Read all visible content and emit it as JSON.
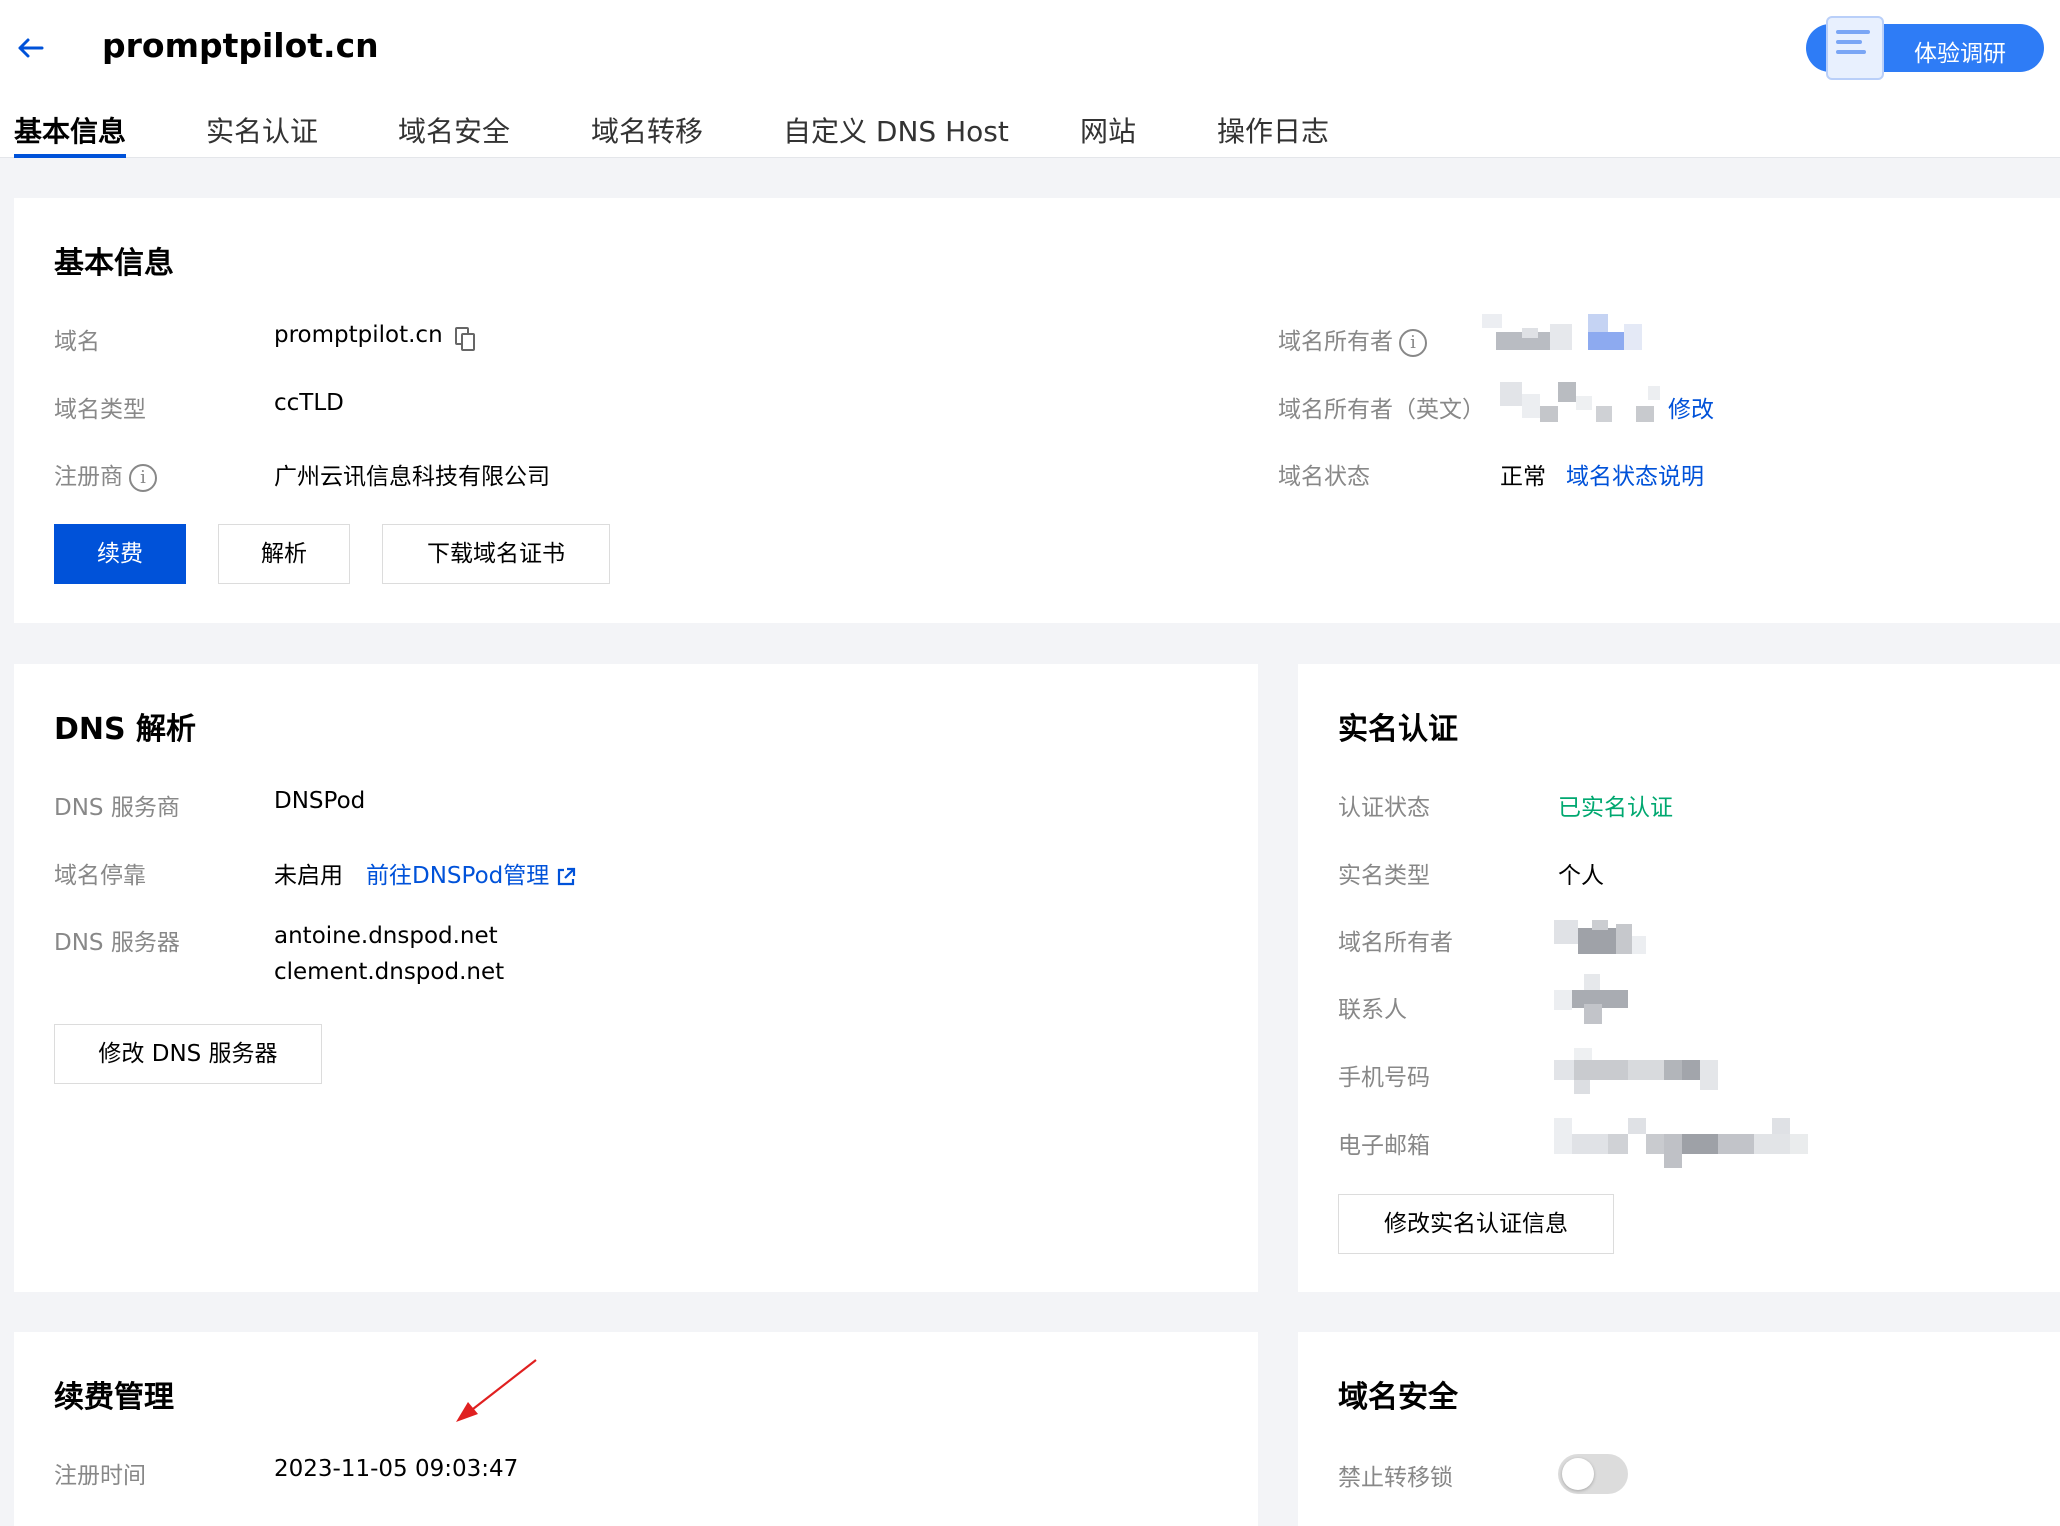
{
  "header": {
    "domain_title": "promptpilot.cn",
    "survey_label": "体验调研",
    "back_icon": "arrow-left-icon",
    "survey_icon": "document-icon"
  },
  "tabs": [
    {
      "label": "基本信息",
      "active": true
    },
    {
      "label": "实名认证"
    },
    {
      "label": "域名安全"
    },
    {
      "label": "域名转移"
    },
    {
      "label": "自定义 DNS Host"
    },
    {
      "label": "网站"
    },
    {
      "label": "操作日志"
    }
  ],
  "basic_info": {
    "title": "基本信息",
    "rows": [
      {
        "label": "域名",
        "value": "promptpilot.cn"
      },
      {
        "label": "域名类型",
        "value": "ccTLD"
      },
      {
        "label": "注册商",
        "value": "广州云讯信息科技有限公司"
      }
    ],
    "right_rows": [
      {
        "label": "域名所有者"
      },
      {
        "label": "域名所有者（英文）",
        "link": "修改"
      },
      {
        "label": "域名状态",
        "value": "正常",
        "link": "域名状态说明"
      }
    ],
    "buttons": {
      "renew": "续费",
      "resolve": "解析",
      "download_cert": "下载域名证书"
    }
  },
  "dns": {
    "title": "DNS 解析",
    "rows": [
      {
        "label": "DNS 服务商",
        "value": "DNSPod"
      },
      {
        "label": "域名停靠",
        "value": "未启用",
        "link": "前往DNSPod管理"
      },
      {
        "label": "DNS 服务器",
        "values": [
          "antoine.dnspod.net",
          "clement.dnspod.net"
        ]
      }
    ],
    "button": "修改 DNS 服务器"
  },
  "real_name": {
    "title": "实名认证",
    "rows": [
      {
        "label": "认证状态",
        "value": "已实名认证"
      },
      {
        "label": "实名类型",
        "value": "个人"
      },
      {
        "label": "域名所有者"
      },
      {
        "label": "联系人"
      },
      {
        "label": "手机号码"
      },
      {
        "label": "电子邮箱"
      }
    ],
    "button": "修改实名认证信息"
  },
  "renewal": {
    "title": "续费管理",
    "rows": [
      {
        "label": "注册时间",
        "value": "2023-11-05 09:03:47"
      }
    ]
  },
  "security": {
    "title": "域名安全",
    "rows": [
      {
        "label": "禁止转移锁",
        "enabled": false
      }
    ]
  },
  "colors": {
    "primary": "#0052d9",
    "success": "#00a870",
    "survey": "#2e7cf6",
    "annotation_arrow": "#e02020"
  }
}
